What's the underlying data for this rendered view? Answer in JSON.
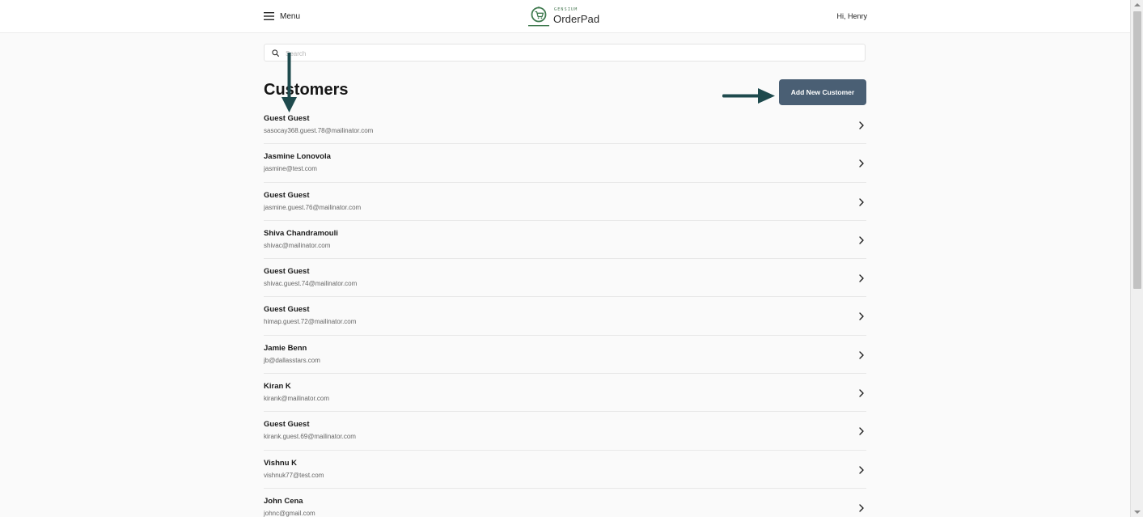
{
  "header": {
    "menu_label": "Menu",
    "logo_brand": "GENSIUM",
    "logo_name": "OrderPad",
    "greeting": "Hi, Henry"
  },
  "search": {
    "placeholder": "Search",
    "value": ""
  },
  "page": {
    "title": "Customers",
    "add_button_label": "Add New Customer"
  },
  "customers": [
    {
      "name": "Guest Guest",
      "email": "sasocay368.guest.78@mailinator.com"
    },
    {
      "name": "Jasmine Lonovola",
      "email": "jasmine@test.com"
    },
    {
      "name": "Guest Guest",
      "email": "jasmine.guest.76@mailinator.com"
    },
    {
      "name": "Shiva Chandramouli",
      "email": "shivac@mailinator.com"
    },
    {
      "name": "Guest Guest",
      "email": "shivac.guest.74@mailinator.com"
    },
    {
      "name": "Guest Guest",
      "email": "himap.guest.72@mailinator.com"
    },
    {
      "name": "Jamie Benn",
      "email": "jb@dallasstars.com"
    },
    {
      "name": "Kiran K",
      "email": "kirank@mailinator.com"
    },
    {
      "name": "Guest Guest",
      "email": "kirank.guest.69@mailinator.com"
    },
    {
      "name": "Vishnu K",
      "email": "vishnuk77@test.com"
    },
    {
      "name": "John Cena",
      "email": "johnc@gmail.com"
    }
  ],
  "icons": {
    "menu": "hamburger-icon",
    "logo": "cart-logo-icon",
    "search": "search-icon",
    "row": "chevron-right-icon",
    "annotation": "arrow-annotation-icon"
  },
  "colors": {
    "add_button": "#4a5f74",
    "annotation_arrow": "#1e4a4d",
    "logo_green": "#3f7a4f"
  }
}
